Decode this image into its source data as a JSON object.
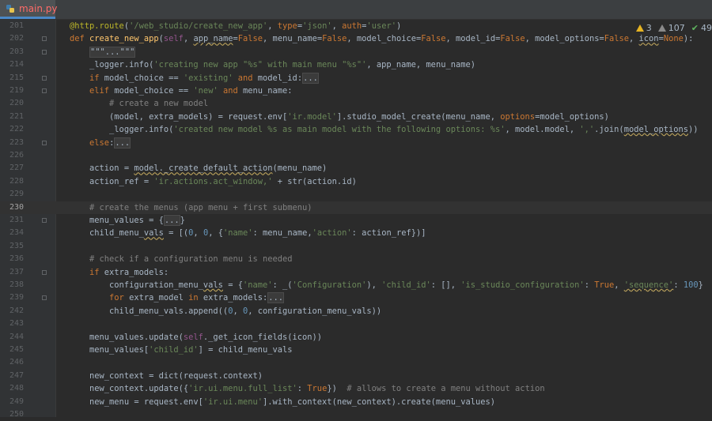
{
  "tab": {
    "filename": "main.py",
    "icon": "python-file-icon"
  },
  "inspection": {
    "errors": "3",
    "warnings": "107",
    "ok": "49"
  },
  "lines": [
    {
      "n": "201",
      "html": "<span class=\"dec\">@http.route</span>(<span class=\"str\">'/web_studio/create_new_app'</span>, <span class=\"kw\">type</span>=<span class=\"str\">'json'</span>, <span class=\"kw\">auth</span>=<span class=\"str\">'user'</span>)"
    },
    {
      "n": "202",
      "html": "<span class=\"kw\">def</span> <span class=\"fn\">create_new_app</span>(<span class=\"self\">self</span>, <span class=\"warn\">app_name</span>=<span class=\"kw\">False</span>, menu_name=<span class=\"kw\">False</span>, model_choice=<span class=\"kw\">False</span>, model_id=<span class=\"kw\">False</span>, model_options=<span class=\"kw\">False</span>, <span class=\"warn\">icon</span>=<span class=\"kw\">None</span>):"
    },
    {
      "n": "203",
      "html": "    <span class=\"fold-box\">\"\"\"...\"\"\"</span>"
    },
    {
      "n": "214",
      "html": "    _logger.info(<span class=\"str\">'creating new app \"%s\" with main menu \"%s\"'</span>, app_name, menu_name)"
    },
    {
      "n": "215",
      "html": "    <span class=\"kw\">if</span> model_choice == <span class=\"str\">'existing'</span> <span class=\"kw\">and</span> model_id:<span class=\"fold-box\">...</span>"
    },
    {
      "n": "219",
      "html": "    <span class=\"kw\">elif</span> model_choice == <span class=\"str\">'new'</span> <span class=\"kw\">and</span> menu_name:"
    },
    {
      "n": "220",
      "html": "        <span class=\"cmt\"># create a new model</span>"
    },
    {
      "n": "221",
      "html": "        (model, extra_models) = request.env[<span class=\"str\">'ir.model'</span>].studio_model_create(menu_name, <span class=\"kw\">options</span>=model_options)"
    },
    {
      "n": "222",
      "html": "        _logger.info(<span class=\"str\">'created new model %s as main model with the following options: %s'</span>, model.model, <span class=\"str\">','</span>.join(<span class=\"warn\">model_options</span>))"
    },
    {
      "n": "223",
      "html": "    <span class=\"kw\">else</span>:<span class=\"fold-box\">...</span>"
    },
    {
      "n": "226",
      "html": ""
    },
    {
      "n": "227",
      "html": "    action = <span class=\"warn\">model._create_default_action</span>(menu_name)"
    },
    {
      "n": "228",
      "html": "    action_ref = <span class=\"str\">'ir.actions.act_window,'</span> + str(action.id)"
    },
    {
      "n": "229",
      "html": ""
    },
    {
      "n": "230",
      "html": "    <span class=\"cmt\"># create the menus (app menu + first submenu)</span>",
      "current": true
    },
    {
      "n": "231",
      "html": "    menu_values = {<span class=\"fold-box\">...</span>}"
    },
    {
      "n": "234",
      "html": "    child_menu_<span class=\"warn\">vals</span> = [(<span class=\"num\">0</span>, <span class=\"num\">0</span>, {<span class=\"str\">'name'</span>: menu_name,<span class=\"str\">'action'</span>: action_ref})]"
    },
    {
      "n": "235",
      "html": ""
    },
    {
      "n": "236",
      "html": "    <span class=\"cmt\"># check if a configuration menu is needed</span>"
    },
    {
      "n": "237",
      "html": "    <span class=\"kw\">if</span> extra_models:"
    },
    {
      "n": "238",
      "html": "        configuration_menu_<span class=\"warn\">vals</span> = {<span class=\"str\">'name'</span>: _(<span class=\"str\">'Configuration'</span>), <span class=\"str\">'child_id'</span>: [], <span class=\"str\">'is_studio_configuration'</span>: <span class=\"kw\">True</span>, <span class=\"str warn\">'sequence'</span>: <span class=\"num\">100</span>}"
    },
    {
      "n": "239",
      "html": "        <span class=\"kw\">for</span> extra_model <span class=\"kw\">in</span> extra_models:<span class=\"fold-box\">...</span>"
    },
    {
      "n": "242",
      "html": "        child_menu_vals.append((<span class=\"num\">0</span>, <span class=\"num\">0</span>, configuration_menu_vals))"
    },
    {
      "n": "243",
      "html": ""
    },
    {
      "n": "244",
      "html": "    menu_values.update(<span class=\"self\">self</span>._get_icon_fields(icon))"
    },
    {
      "n": "245",
      "html": "    menu_values[<span class=\"str\">'child_id'</span>] = child_menu_vals"
    },
    {
      "n": "246",
      "html": ""
    },
    {
      "n": "247",
      "html": "    new_context = dict(request.context)"
    },
    {
      "n": "248",
      "html": "    new_context.update({<span class=\"str\">'ir.ui.menu.full_list'</span>: <span class=\"kw\">True</span>})  <span class=\"cmt\"># allows to create a menu without action</span>"
    },
    {
      "n": "249",
      "html": "    new_menu = request.env[<span class=\"str\">'ir.ui.menu'</span>].with_context(new_context).create(menu_values)"
    },
    {
      "n": "250",
      "html": ""
    }
  ],
  "folds": [
    "202",
    "203",
    "215",
    "219",
    "223",
    "231",
    "237",
    "239"
  ]
}
